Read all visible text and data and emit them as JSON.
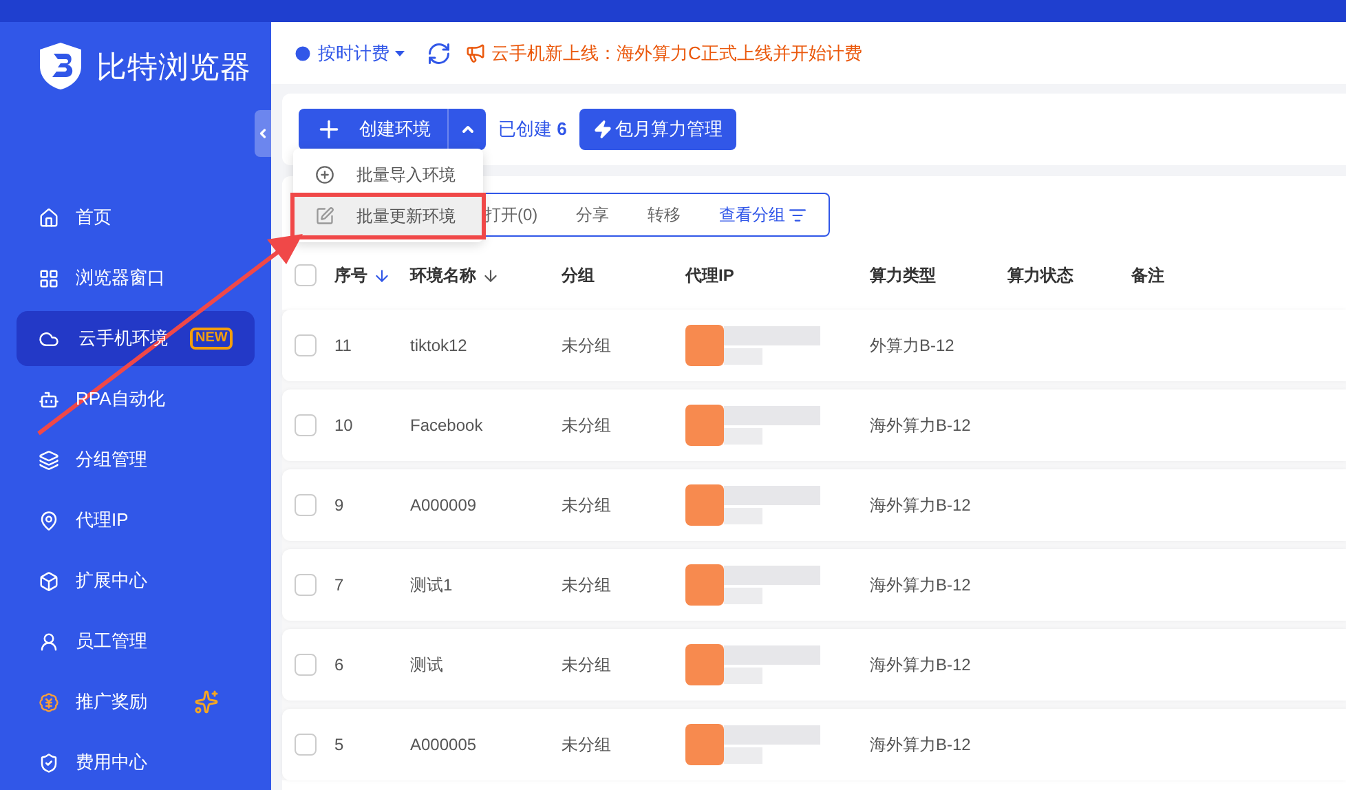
{
  "sidebar": {
    "brand": "比特浏览器",
    "items": [
      {
        "label": "首页",
        "selected": false
      },
      {
        "label": "浏览器窗口",
        "selected": false
      },
      {
        "label": "云手机环境",
        "selected": true,
        "badge": "NEW"
      },
      {
        "label": "RPA自动化",
        "selected": false
      },
      {
        "label": "分组管理",
        "selected": false
      },
      {
        "label": "代理IP",
        "selected": false
      },
      {
        "label": "扩展中心",
        "selected": false
      },
      {
        "label": "员工管理",
        "selected": false
      },
      {
        "label": "推广奖励",
        "selected": false,
        "sparkle": true
      },
      {
        "label": "费用中心",
        "selected": false
      }
    ]
  },
  "topbar": {
    "billing": "按时计费",
    "notice": "云手机新上线：海外算力C正式上线并开始计费"
  },
  "actions": {
    "create": "创建环境",
    "created_label": "已创建",
    "created_count": "6",
    "monthly": "包月算力管理"
  },
  "dropdown": [
    {
      "label": "批量导入环境",
      "highlighted": false
    },
    {
      "label": "批量更新环境",
      "highlighted": true
    }
  ],
  "toolbar": [
    "打开(0)",
    "分享",
    "转移",
    "查看分组"
  ],
  "table": {
    "all_checked": false,
    "columns": [
      {
        "label": "序号",
        "sort": true
      },
      {
        "label": "环境名称",
        "sort": true
      },
      {
        "label": "分组",
        "sort": false
      },
      {
        "label": "代理IP",
        "sort": false
      },
      {
        "label": "算力类型",
        "sort": false
      },
      {
        "label": "算力状态",
        "sort": false
      },
      {
        "label": "备注",
        "sort": false
      }
    ],
    "rows": [
      {
        "seq": "11",
        "name": "tiktok12",
        "group": "未分组",
        "type": "外算力B-12",
        "checked": false
      },
      {
        "seq": "10",
        "name": "Facebook",
        "group": "未分组",
        "type": "海外算力B-12",
        "checked": false
      },
      {
        "seq": "9",
        "name": "A000009",
        "group": "未分组",
        "type": "海外算力B-12",
        "checked": false
      },
      {
        "seq": "7",
        "name": "测试1",
        "group": "未分组",
        "type": "海外算力B-12",
        "checked": false
      },
      {
        "seq": "6",
        "name": "测试",
        "group": "未分组",
        "type": "海外算力B-12",
        "checked": false
      },
      {
        "seq": "5",
        "name": "A000005",
        "group": "未分组",
        "type": "海外算力B-12",
        "checked": false
      }
    ]
  }
}
